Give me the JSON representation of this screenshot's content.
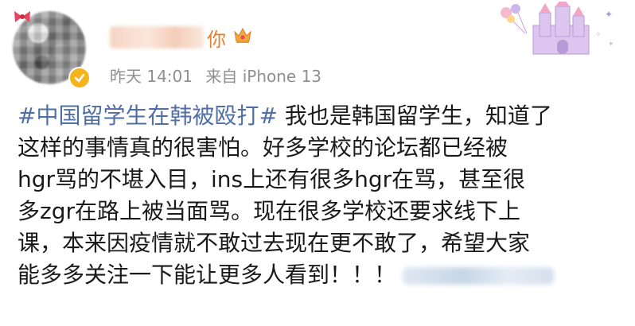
{
  "user": {
    "name_visible_suffix": "你",
    "avatar_icon": "avatar",
    "verified_icon": "verified-check-icon",
    "crown_icon": "crown-icon"
  },
  "meta": {
    "time": "昨天 14:01",
    "source": "来自 iPhone 13"
  },
  "decoration": {
    "castle_icon": "castle-balloons-icon"
  },
  "post": {
    "hashtag": "#中国留学生在韩被殴打#",
    "lines": [
      " 我也是韩国留学生，知道了",
      "这样的事情真的很害怕。好多学校的论坛都已经被",
      "hgr骂的不堪入目，ins上还有很多hgr在骂，甚至很",
      "多zgr在路上被当面骂。现在很多学校还要求线下上",
      "课，本来因疫情就不敢过去现在更不敢了，希望大家",
      "能多多关注一下能让更多人看到！！！"
    ]
  },
  "colors": {
    "hashtag": "#506fa6",
    "username": "#ea7d2c",
    "meta": "#8f8f8f",
    "badge": "#f5b41c"
  }
}
